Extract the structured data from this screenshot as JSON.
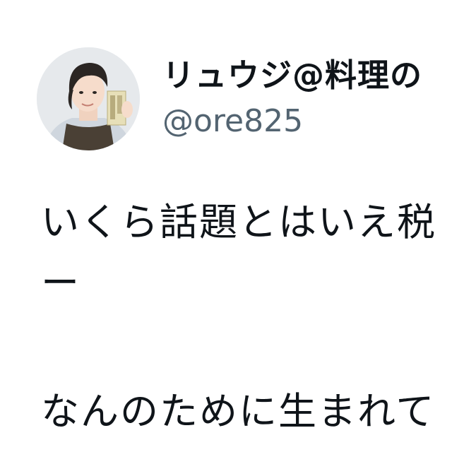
{
  "author": {
    "display_name": "リュウジ@料理の",
    "handle": "@ore825",
    "avatar_icon": "profile-photo"
  },
  "tweet": {
    "line1": "いくら話題とはいえ税",
    "line2": "ー",
    "line3": "なんのために生まれて"
  },
  "colors": {
    "text": "#0f1419",
    "handle": "#536471",
    "background": "#ffffff"
  }
}
